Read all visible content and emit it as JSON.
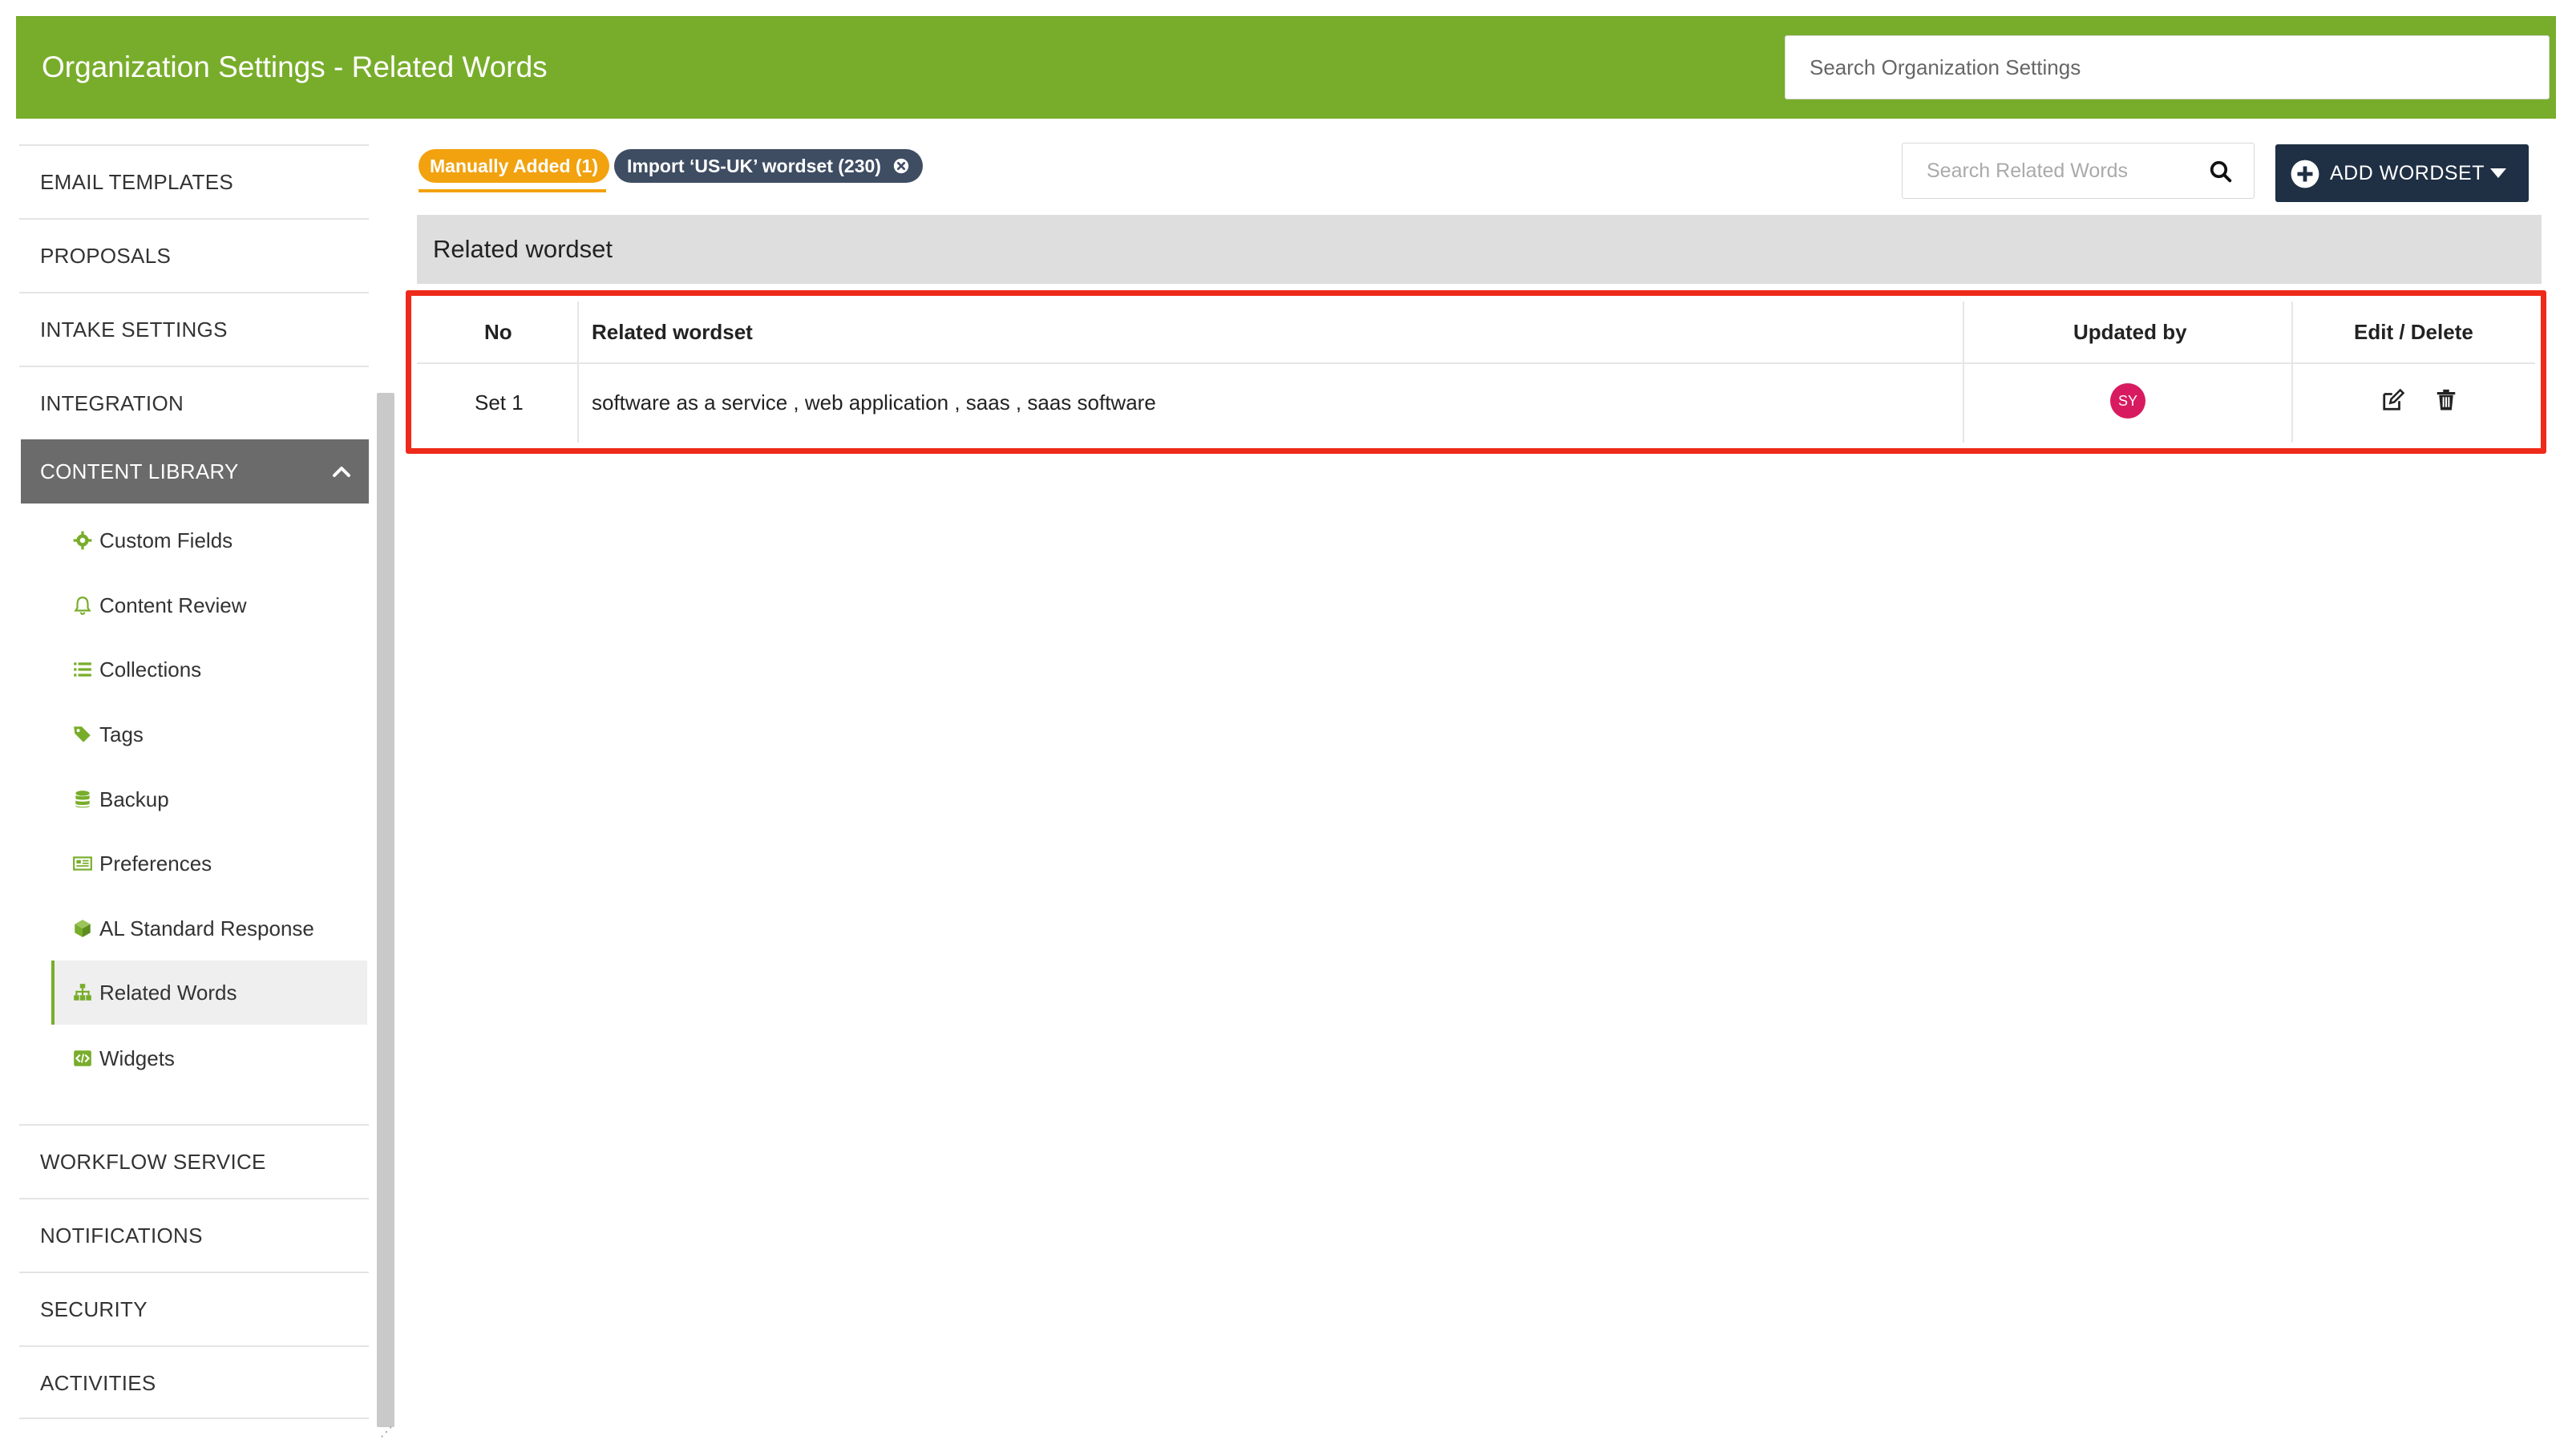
{
  "header": {
    "title": "Organization Settings - Related Words",
    "search_placeholder": "Search Organization Settings"
  },
  "sidebar": {
    "items_top": [
      {
        "label": "EMAIL TEMPLATES"
      },
      {
        "label": "PROPOSALS"
      },
      {
        "label": "INTAKE SETTINGS"
      },
      {
        "label": "INTEGRATION"
      }
    ],
    "section": {
      "label": "CONTENT LIBRARY"
    },
    "sub_items": [
      {
        "label": "Custom Fields",
        "icon": "gear-icon"
      },
      {
        "label": "Content Review",
        "icon": "bell-icon"
      },
      {
        "label": "Collections",
        "icon": "list-icon"
      },
      {
        "label": "Tags",
        "icon": "tags-icon"
      },
      {
        "label": "Backup",
        "icon": "database-icon"
      },
      {
        "label": "Preferences",
        "icon": "preferences-icon"
      },
      {
        "label": "AL Standard Response",
        "icon": "cube-icon"
      },
      {
        "label": "Related Words",
        "icon": "sitemap-icon",
        "active": true
      },
      {
        "label": "Widgets",
        "icon": "code-icon"
      }
    ],
    "items_bottom": [
      {
        "label": "WORKFLOW SERVICE"
      },
      {
        "label": "NOTIFICATIONS"
      },
      {
        "label": "SECURITY"
      },
      {
        "label": "ACTIVITIES"
      }
    ]
  },
  "filters": {
    "manual": "Manually Added (1)",
    "import": "Import ‘US-UK’ wordset (230)"
  },
  "toolbar": {
    "search_placeholder": "Search Related Words",
    "add_label": "ADD WORDSET"
  },
  "panel": {
    "title": "Related wordset"
  },
  "table": {
    "headers": {
      "no": "No",
      "wordset": "Related wordset",
      "updated_by": "Updated by",
      "actions": "Edit / Delete"
    },
    "rows": [
      {
        "no": "Set 1",
        "wordset": "software as a service , web application , saas , saas software",
        "updated_by": "SY"
      }
    ]
  },
  "colors": {
    "brand_green": "#78ad2b",
    "chip_orange": "#f2a20f",
    "chip_dark": "#3f4d63",
    "button_navy": "#1f2f44",
    "highlight_red": "#ee2a1a",
    "avatar_pink": "#d81b60"
  }
}
